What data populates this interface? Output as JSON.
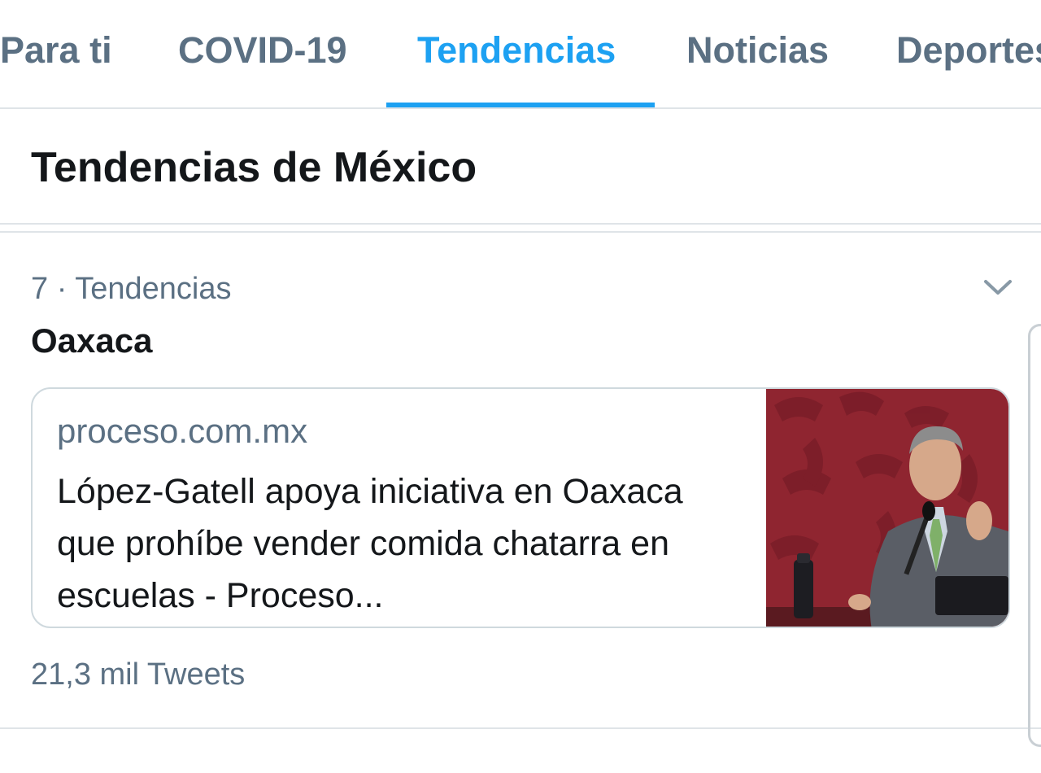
{
  "tabs": [
    {
      "label": "Para ti"
    },
    {
      "label": "COVID-19"
    },
    {
      "label": "Tendencias"
    },
    {
      "label": "Noticias"
    },
    {
      "label": "Deportes"
    }
  ],
  "active_tab": "Tendencias",
  "section": {
    "title": "Tendencias de México"
  },
  "trend": {
    "meta": "7 · Tendencias",
    "name": "Oaxaca",
    "card": {
      "source": "proceso.com.mx",
      "headline": "López-Gatell apoya iniciativa en Oaxaca que prohíbe vender comida chatarra en escuelas - Proceso..."
    },
    "tweet_count": "21,3 mil Tweets"
  },
  "colors": {
    "accent": "#1da1f2",
    "secondary_text": "#5b7083",
    "primary_text": "#14171a",
    "border": "#dfe4e8"
  },
  "icons": {
    "caret": "chevron-down-icon"
  }
}
